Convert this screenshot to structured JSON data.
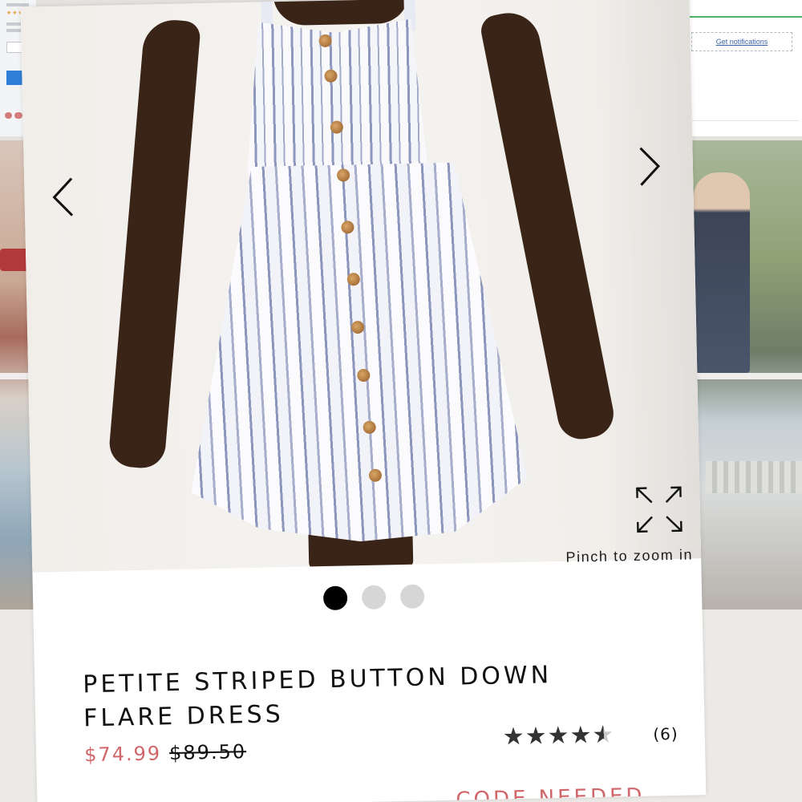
{
  "background": {
    "notify_button_label": "Get notifications"
  },
  "carousel": {
    "prev_icon": "chevron-left-icon",
    "next_icon": "chevron-right-icon",
    "expand_icon": "expand-icon",
    "zoom_hint": "Pinch to zoom in",
    "slide_count": 3,
    "active_slide": 1
  },
  "product": {
    "title": "PETITE STRIPED BUTTON DOWN FLARE DRESS",
    "sale_price": "$74.99",
    "original_price": "$89.50",
    "rating": 4.5,
    "rating_max": 5,
    "review_count": "(6)",
    "promo_text": "CODE NEEDED"
  },
  "colors": {
    "sale_price": "#d0666a",
    "active_dot": "#000000",
    "inactive_dot": "#d6d6d6",
    "star": "#333333"
  }
}
